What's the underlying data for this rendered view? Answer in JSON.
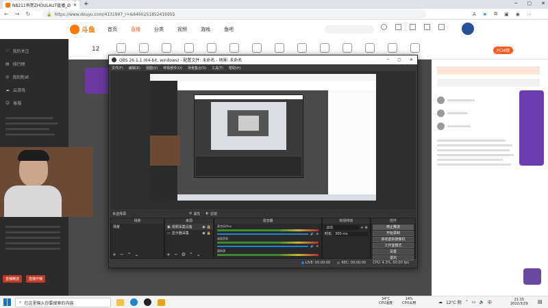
{
  "browser": {
    "tab_title": "N8211有死ZHOULAUT直播_Ø",
    "url": "https://www.douyu.com/4131997_r=&6460251852416955"
  },
  "site": {
    "logo": "斗鱼",
    "nav": [
      "首页",
      "直播",
      "分类",
      "视频",
      "游戏",
      "鱼吧"
    ],
    "left_nav": [
      "我的关注",
      "排行榜",
      "我的粉丝",
      "云游戏",
      "客服"
    ],
    "date_badge": "12",
    "pcm_badge": "PCM榜",
    "side_bottom_left": "直播精选",
    "side_bottom_right": "直播开播"
  },
  "obs": {
    "window_title": "OBS 26.1.1 (64-bit, windows) - 配置文件: 未命名 - 场景: 未命名",
    "menu": [
      "文件(F)",
      "编辑(E)",
      "视图(V)",
      "停靠部件(D)",
      "场景集合(S)",
      "工具(T)",
      "帮助(H)"
    ],
    "status_label": "未选择源",
    "btn_props": "属性",
    "btn_filters": "滤镜",
    "docks": {
      "scenes": {
        "title": "场景",
        "items": [
          "场景"
        ]
      },
      "sources": {
        "title": "来源",
        "items": [
          "视频采集设备",
          "显示器采集"
        ]
      },
      "mixer": {
        "title": "混音器",
        "channels": [
          "麦克风/Aux",
          "桌面音频",
          "媒体源"
        ]
      },
      "transitions": {
        "title": "转场特效",
        "type": "淡出",
        "duration_label": "时长",
        "duration": "300 ms"
      },
      "controls": {
        "title": "控件",
        "buttons": [
          "停止推流",
          "开始录制",
          "启动虚拟摄像机",
          "工作室模式",
          "设置",
          "退出"
        ]
      }
    },
    "statusbar": {
      "live": "LIVE: 00:00:00",
      "rec": "REC: 00:00:00",
      "cpu": "CPU: 4.3%, 60.00 fps"
    }
  },
  "taskbar": {
    "search_placeholder": "在这里输入你要搜索的内容",
    "cpu_temp": "34°C",
    "cpu_temp_label": "CPU温度",
    "cpu_usage": "14%",
    "cpu_usage_label": "CPU占用",
    "weather": "12°C 阴",
    "time": "21:15",
    "date": "2022/3/29"
  },
  "colors": {
    "accent": "#ff5d23",
    "obs_bg": "#3a3a3a",
    "douyu_orange": "#ff7700"
  }
}
